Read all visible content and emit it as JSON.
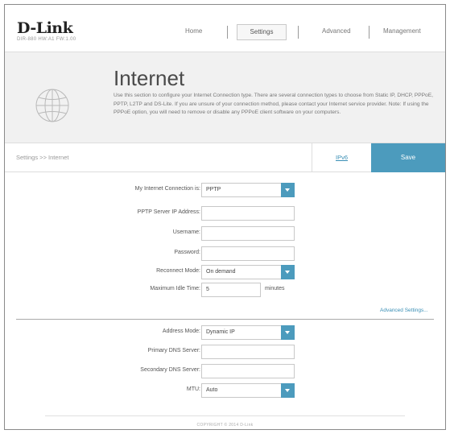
{
  "brand": {
    "logo": "D-Link",
    "model": "DIR-880   HW:A1   FW:1.00"
  },
  "nav": {
    "home": "Home",
    "settings": "Settings",
    "advanced": "Advanced",
    "management": "Management"
  },
  "banner": {
    "title": "Internet",
    "description": "Use this section to configure your Internet Connection type. There are several connection types to choose from Static IP, DHCP, PPPoE, PPTP, L2TP and DS-Lite. If you are unsure of your connection method, please contact your Internet service provider. Note: If using the PPPoE option, you will need to remove or disable any PPPoE client software on your computers."
  },
  "breadcrumb": "Settings >> Internet",
  "actions": {
    "ipv6": "IPv6",
    "save": "Save"
  },
  "form": {
    "connection": {
      "label": "My Internet Connection is:",
      "value": "PPTP"
    },
    "server_ip": {
      "label": "PPTP Server IP Address:",
      "value": ""
    },
    "username": {
      "label": "Username:",
      "value": ""
    },
    "password": {
      "label": "Password:",
      "value": ""
    },
    "reconnect": {
      "label": "Reconnect Mode:",
      "value": "On demand"
    },
    "idle_time": {
      "label": "Maximum Idle Time:",
      "value": "5",
      "unit": "minutes"
    },
    "advanced_link": "Advanced Settings...",
    "address_mode": {
      "label": "Address Mode:",
      "value": "Dynamic IP"
    },
    "primary_dns": {
      "label": "Primary DNS Server:",
      "value": ""
    },
    "secondary_dns": {
      "label": "Secondary DNS Server:",
      "value": ""
    },
    "mtu": {
      "label": "MTU:",
      "value": "Auto"
    }
  },
  "footer": "COPYRIGHT © 2014 D-Link",
  "colors": {
    "accent": "#4c9bbd",
    "banner_bg": "#f1f1f1"
  }
}
